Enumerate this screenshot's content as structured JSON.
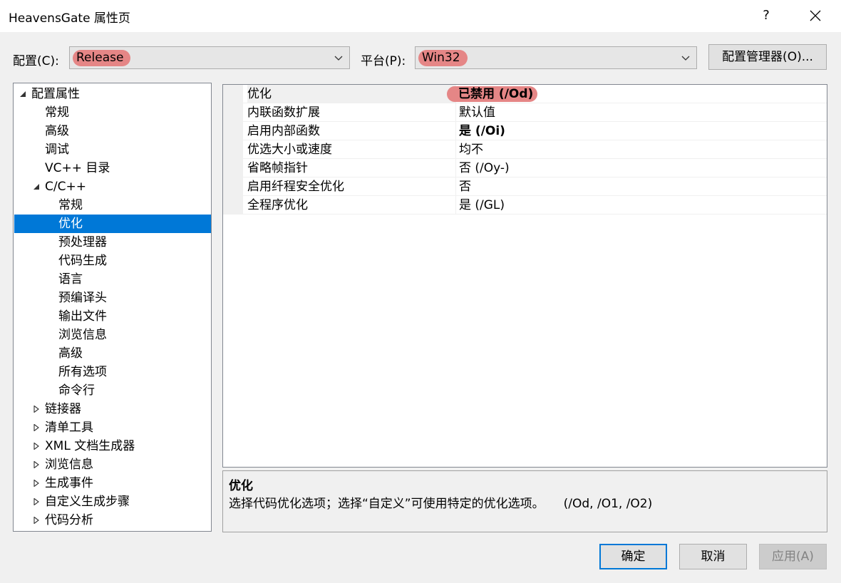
{
  "window": {
    "title": "HeavensGate 属性页",
    "help_label": "?"
  },
  "config_bar": {
    "config_label": "配置(C):",
    "config_value": "Release",
    "platform_label": "平台(P):",
    "platform_value": "Win32",
    "manager_button": "配置管理器(O)..."
  },
  "tree": {
    "items": [
      {
        "label": "配置属性",
        "expander": "expanded"
      },
      {
        "label": "常规",
        "expander": "none"
      },
      {
        "label": "高级",
        "expander": "none"
      },
      {
        "label": "调试",
        "expander": "none"
      },
      {
        "label": "VC++ 目录",
        "expander": "none"
      },
      {
        "label": "C/C++",
        "expander": "expanded"
      },
      {
        "label": "常规",
        "expander": "none"
      },
      {
        "label": "优化",
        "expander": "none",
        "selected": true
      },
      {
        "label": "预处理器",
        "expander": "none"
      },
      {
        "label": "代码生成",
        "expander": "none"
      },
      {
        "label": "语言",
        "expander": "none"
      },
      {
        "label": "预编译头",
        "expander": "none"
      },
      {
        "label": "输出文件",
        "expander": "none"
      },
      {
        "label": "浏览信息",
        "expander": "none"
      },
      {
        "label": "高级",
        "expander": "none"
      },
      {
        "label": "所有选项",
        "expander": "none"
      },
      {
        "label": "命令行",
        "expander": "none"
      },
      {
        "label": "链接器",
        "expander": "collapsed"
      },
      {
        "label": "清单工具",
        "expander": "collapsed"
      },
      {
        "label": "XML 文档生成器",
        "expander": "collapsed"
      },
      {
        "label": "浏览信息",
        "expander": "collapsed"
      },
      {
        "label": "生成事件",
        "expander": "collapsed"
      },
      {
        "label": "自定义生成步骤",
        "expander": "collapsed"
      },
      {
        "label": "代码分析",
        "expander": "collapsed"
      }
    ]
  },
  "grid": {
    "rows": [
      {
        "name": "优化",
        "value": "已禁用 (/Od)"
      },
      {
        "name": "内联函数扩展",
        "value": "默认值"
      },
      {
        "name": "启用内部函数",
        "value": "是 (/Oi)"
      },
      {
        "name": "优选大小或速度",
        "value": "均不"
      },
      {
        "name": "省略帧指针",
        "value": "否 (/Oy-)"
      },
      {
        "name": "启用纤程安全优化",
        "value": "否"
      },
      {
        "name": "全程序优化",
        "value": "是 (/GL)"
      }
    ]
  },
  "description": {
    "title": "优化",
    "text": "选择代码优化选项；选择“自定义”可使用特定的优化选项。     (/Od, /O1, /O2)"
  },
  "buttons": {
    "ok": "确定",
    "cancel": "取消",
    "apply": "应用(A)"
  },
  "colors": {
    "selection": "#0078d7",
    "highlight": "#e58686",
    "background": "#f0f0f0"
  }
}
